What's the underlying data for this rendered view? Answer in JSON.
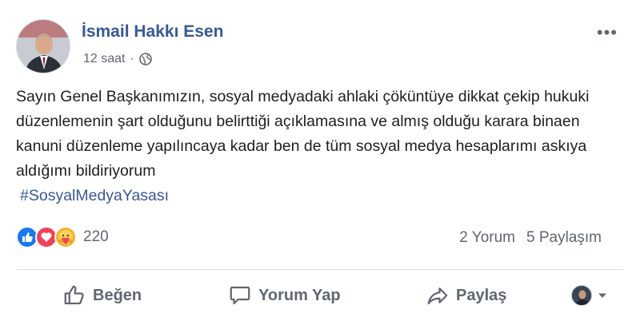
{
  "post": {
    "author": "İsmail Hakkı Esen",
    "time": "12 saat",
    "separator": "·",
    "text": "Sayın Genel Başkanımızın, sosyal medyadaki ahlaki çöküntüye dikkat çekip hukuki düzenlemenin şart olduğunu belirttiği açıklamasına ve almış olduğu karara binaen kanuni düzenleme yapılıncaya kadar ben de tüm sosyal medya hesaplarımı askıya aldığımı bildiriyorum",
    "hashtag": "#SosyalMedyaYasası",
    "more": "•••"
  },
  "stats": {
    "reactions_count": "220",
    "comments": "2 Yorum",
    "shares": "5 Paylaşım"
  },
  "actions": {
    "like": "Beğen",
    "comment": "Yorum Yap",
    "share": "Paylaş"
  },
  "colors": {
    "link": "#385898",
    "like": "#1877f2",
    "love": "#f33e58",
    "care": "#f7b125",
    "muted": "#606770"
  }
}
